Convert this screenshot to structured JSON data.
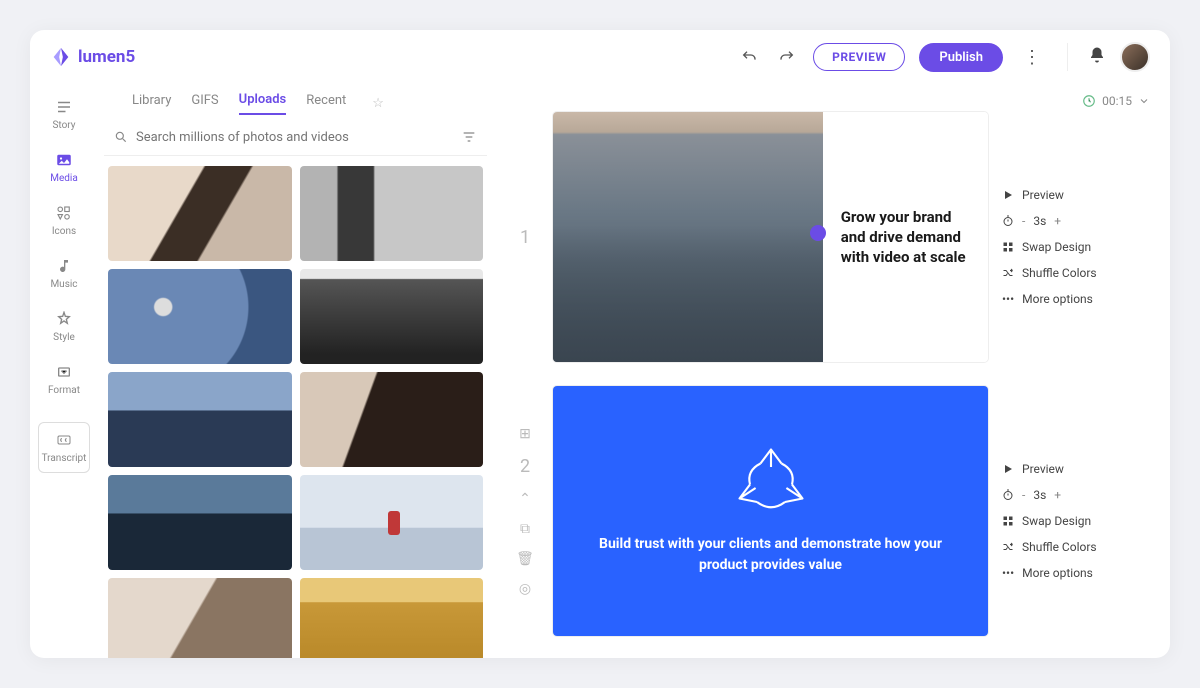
{
  "brand": "lumen5",
  "header": {
    "preview": "PREVIEW",
    "publish": "Publish"
  },
  "sidebar": {
    "items": [
      {
        "label": "Story",
        "icon": "story"
      },
      {
        "label": "Media",
        "icon": "media"
      },
      {
        "label": "Icons",
        "icon": "icons"
      },
      {
        "label": "Music",
        "icon": "music"
      },
      {
        "label": "Style",
        "icon": "style"
      },
      {
        "label": "Format",
        "icon": "format"
      },
      {
        "label": "Transcript",
        "icon": "cc"
      }
    ],
    "active_index": 1
  },
  "media": {
    "tabs": [
      "Library",
      "GIFS",
      "Uploads",
      "Recent"
    ],
    "active_tab": 2,
    "search_placeholder": "Search millions of photos and videos"
  },
  "timer": "00:15",
  "slides": [
    {
      "index": "1",
      "text": "Grow your brand and drive demand with video at scale",
      "duration": "3s"
    },
    {
      "index": "2",
      "text": "Build trust with your clients and demonstrate how your product provides value",
      "duration": "3s"
    }
  ],
  "slide_menu": {
    "preview": "Preview",
    "swap": "Swap Design",
    "shuffle": "Shuffle Colors",
    "more": "More options"
  }
}
